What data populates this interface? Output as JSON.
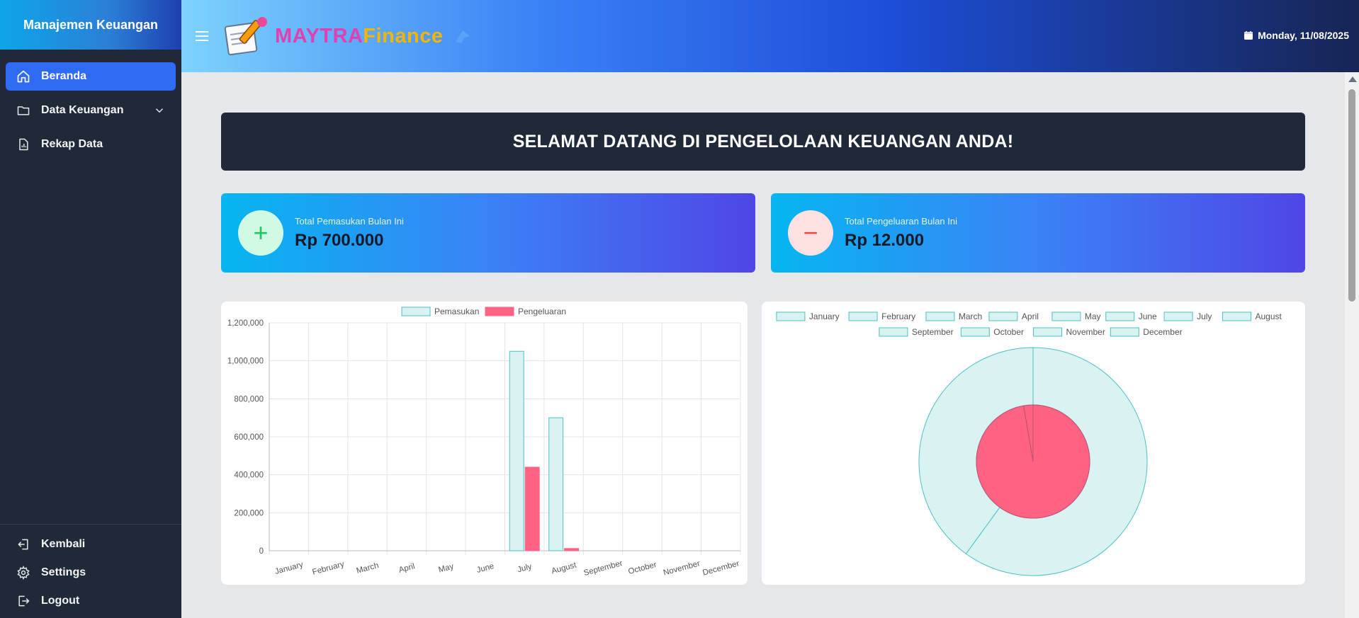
{
  "sidebar": {
    "title": "Manajemen Keuangan",
    "items": [
      {
        "label": "Beranda",
        "active": true
      },
      {
        "label": "Data Keuangan",
        "active": false
      },
      {
        "label": "Rekap Data",
        "active": false
      }
    ],
    "bottom_items": [
      {
        "label": "Kembali"
      },
      {
        "label": "Settings"
      },
      {
        "label": "Logout"
      }
    ]
  },
  "header": {
    "logo_part1": "MAYTRA",
    "logo_part2": "Finance",
    "date": "Monday, 11/08/2025"
  },
  "welcome": "SELAMAT DATANG DI PENGELOLAAN KEUANGAN ANDA!",
  "stats": {
    "income": {
      "label": "Total Pemasukan Bulan Ini",
      "value": "Rp 700.000",
      "symbol": "+"
    },
    "expense": {
      "label": "Total Pengeluaran Bulan Ini",
      "value": "Rp 12.000",
      "symbol": "−"
    }
  },
  "colors": {
    "income_fill": "#d9f2f2",
    "income_stroke": "#4fc0c0",
    "expense_fill": "#ff6384",
    "accent": "#2f6bf2"
  },
  "chart_data": [
    {
      "type": "bar",
      "categories": [
        "January",
        "February",
        "March",
        "April",
        "May",
        "June",
        "July",
        "August",
        "September",
        "October",
        "November",
        "December"
      ],
      "series": [
        {
          "name": "Pemasukan",
          "values": [
            0,
            0,
            0,
            0,
            0,
            0,
            1050000,
            700000,
            0,
            0,
            0,
            0
          ]
        },
        {
          "name": "Pengeluaran",
          "values": [
            0,
            0,
            0,
            0,
            0,
            0,
            440000,
            12000,
            0,
            0,
            0,
            0
          ]
        }
      ],
      "ylim": [
        0,
        1200000
      ],
      "yticks": [
        0,
        200000,
        400000,
        600000,
        800000,
        1000000,
        1200000
      ],
      "ytick_labels": [
        "0",
        "200,000",
        "400,000",
        "600,000",
        "800,000",
        "1,000,000",
        "1,200,000"
      ],
      "legend": "top",
      "grid": true
    },
    {
      "type": "pie",
      "labels": [
        "January",
        "February",
        "March",
        "April",
        "May",
        "June",
        "July",
        "August",
        "September",
        "October",
        "November",
        "December"
      ],
      "outer_values": [
        0,
        0,
        0,
        0,
        0,
        0,
        1050000,
        700000,
        0,
        0,
        0,
        0
      ],
      "inner_values": [
        0,
        0,
        0,
        0,
        0,
        0,
        440000,
        12000,
        0,
        0,
        0,
        0
      ],
      "legend": "top"
    }
  ]
}
